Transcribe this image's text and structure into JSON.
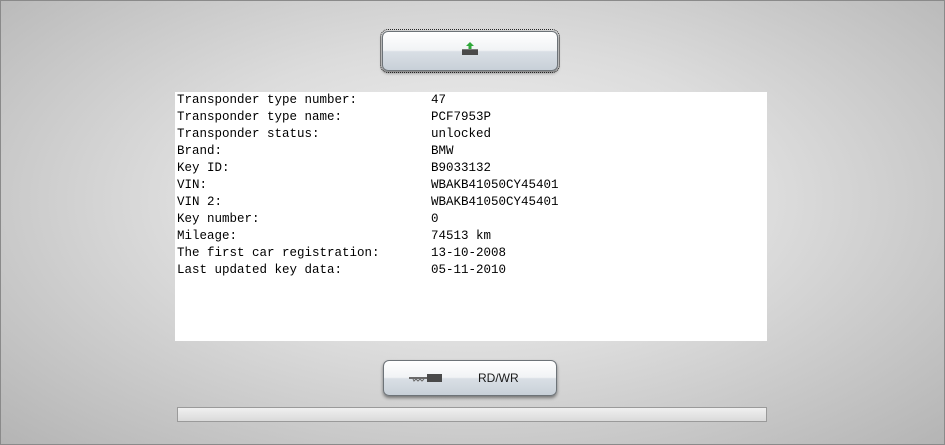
{
  "toolbar": {
    "read_write_label": "RD/WR"
  },
  "key_info": {
    "rows": [
      {
        "label": "Transponder type number:",
        "value": "47"
      },
      {
        "label": "Transponder type name:",
        "value": "PCF7953P"
      },
      {
        "label": "Transponder status:",
        "value": "unlocked"
      },
      {
        "label": "Brand:",
        "value": "BMW"
      },
      {
        "label": "Key ID:",
        "value": "B9033132"
      },
      {
        "label": "VIN:",
        "value": "WBAKB41050CY45401"
      },
      {
        "label": "VIN 2:",
        "value": "WBAKB41050CY45401"
      },
      {
        "label": "Key number:",
        "value": "0"
      },
      {
        "label": "Mileage:",
        "value": "74513 km"
      },
      {
        "label": "The first car registration:",
        "value": "13-10-2008"
      },
      {
        "label": "Last updated key data:",
        "value": "05-11-2010"
      }
    ]
  },
  "progress": {
    "fraction": 0
  },
  "icons": {
    "top_button": "upload-chip-icon",
    "bottom_button": "key-blade-icon"
  },
  "colors": {
    "upload_arrow": "#2fa83a",
    "chip": "#4a4a4a"
  }
}
